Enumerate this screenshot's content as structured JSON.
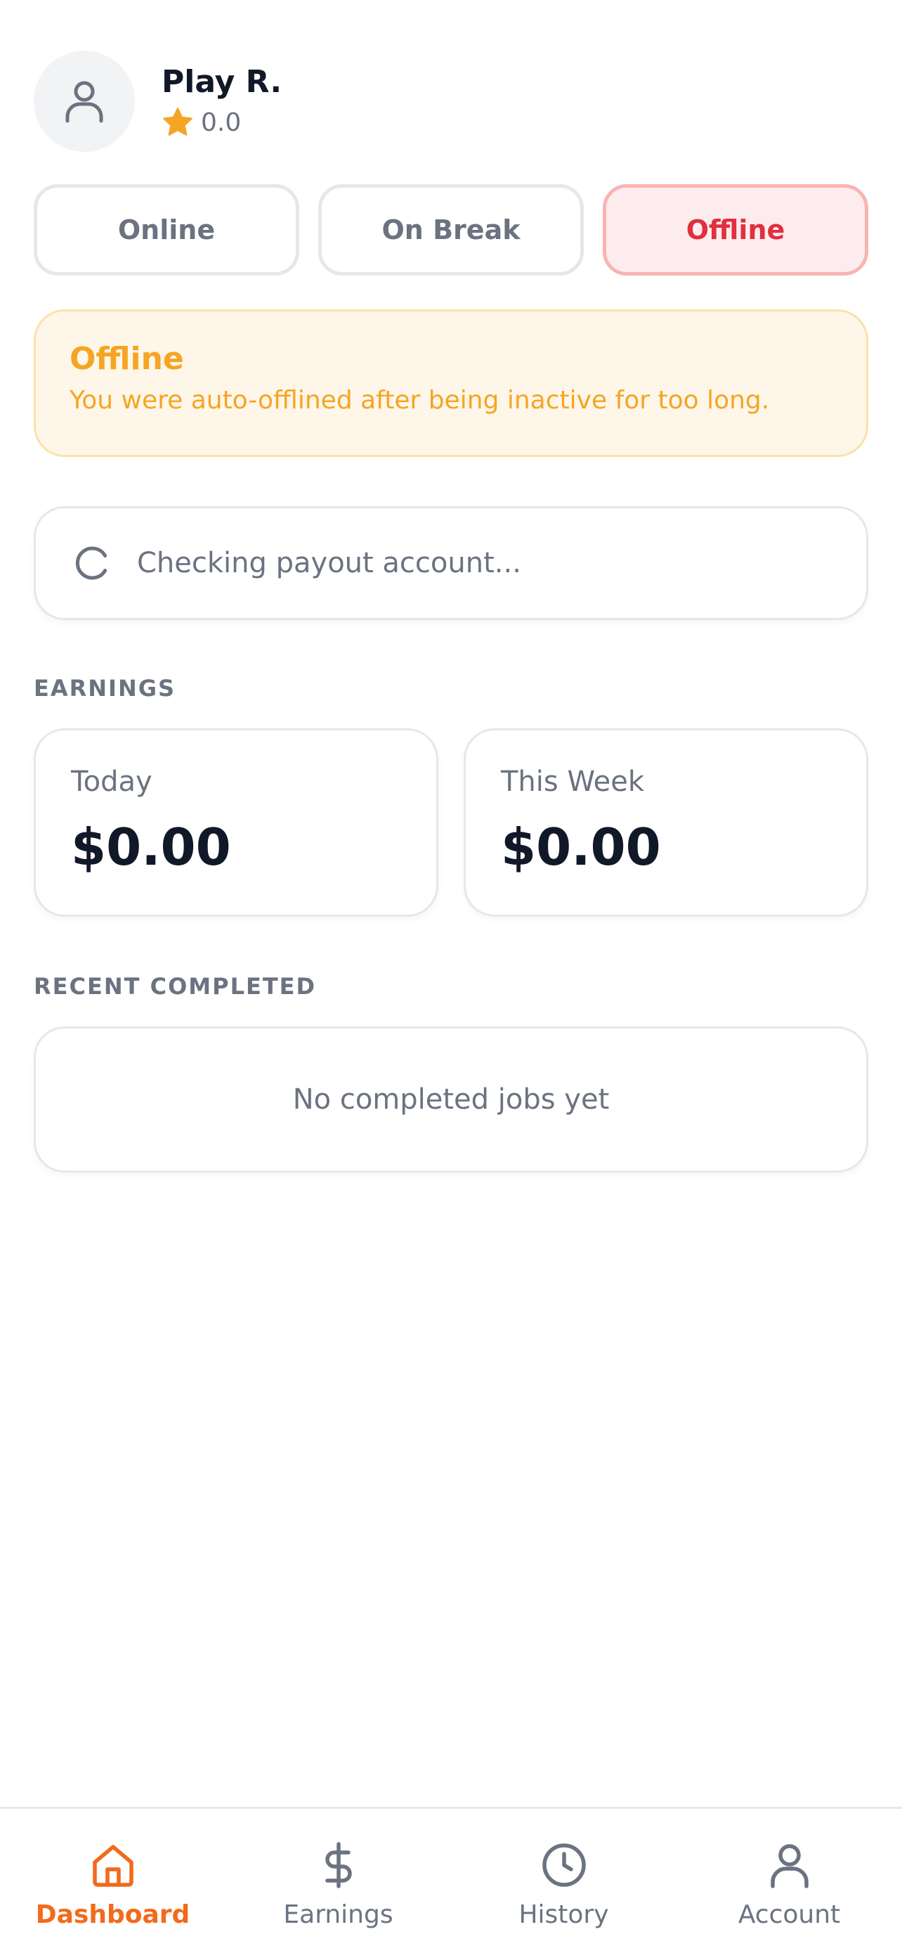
{
  "profile": {
    "name": "Play R.",
    "rating": "0.0",
    "avatar_icon": "user-icon",
    "rating_icon": "star-icon"
  },
  "status": {
    "options": [
      {
        "label": "Online",
        "active": false
      },
      {
        "label": "On Break",
        "active": false
      },
      {
        "label": "Offline",
        "active": true
      }
    ]
  },
  "notice": {
    "title": "Offline",
    "message": "You were auto-offlined after being inactive for too long."
  },
  "payout": {
    "icon": "spinner-icon",
    "text": "Checking payout account..."
  },
  "earnings": {
    "section_label": "EARNINGS",
    "today": {
      "label": "Today",
      "value": "$0.00"
    },
    "week": {
      "label": "This Week",
      "value": "$0.00"
    }
  },
  "recent": {
    "section_label": "RECENT COMPLETED",
    "empty_text": "No completed jobs yet"
  },
  "nav": {
    "items": [
      {
        "label": "Dashboard",
        "icon": "home-icon",
        "active": true
      },
      {
        "label": "Earnings",
        "icon": "dollar-icon",
        "active": false
      },
      {
        "label": "History",
        "icon": "clock-icon",
        "active": false
      },
      {
        "label": "Account",
        "icon": "user-icon",
        "active": false
      }
    ]
  },
  "colors": {
    "accent": "#f26a1b",
    "offline_red": "#e0303f",
    "warning_amber": "#f5a524",
    "star": "#f5a524",
    "muted_text": "#6b7280"
  }
}
